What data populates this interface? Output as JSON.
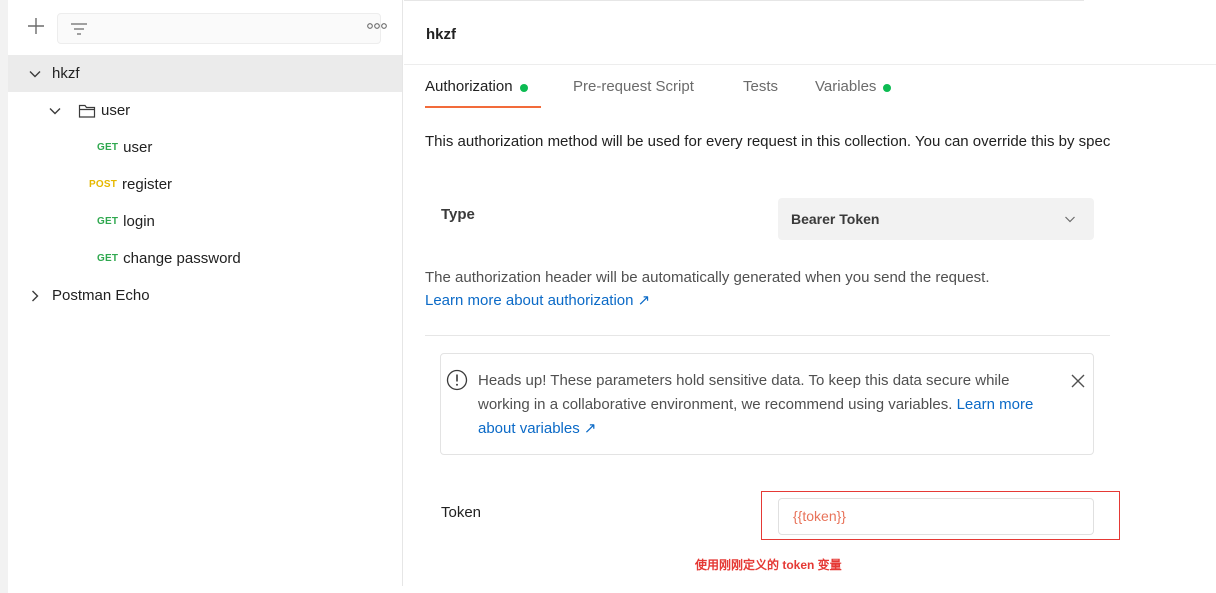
{
  "sidebar": {
    "add_icon": "plus-icon",
    "filter_icon": "filter-icon",
    "more_icon": "more-horizontal-icon",
    "tree": [
      {
        "label": "hkzf",
        "method": "",
        "expanded": true,
        "selected": true
      },
      {
        "label": "user",
        "method": "",
        "expanded": true,
        "folder": true
      },
      {
        "label": "user",
        "method": "GET"
      },
      {
        "label": "register",
        "method": "POST"
      },
      {
        "label": "login",
        "method": "GET"
      },
      {
        "label": "change password",
        "method": "GET"
      },
      {
        "label": "Postman Echo",
        "method": "",
        "expanded": false
      }
    ]
  },
  "collection": {
    "title": "hkzf",
    "tabs": [
      {
        "label": "Authorization",
        "has_dot": true,
        "active": true
      },
      {
        "label": "Pre-request Script",
        "has_dot": false
      },
      {
        "label": "Tests",
        "has_dot": false
      },
      {
        "label": "Variables",
        "has_dot": true
      }
    ],
    "description": "This authorization method will be used for every request in this collection. You can override this by spec"
  },
  "auth": {
    "type_label": "Type",
    "type_value": "Bearer Token",
    "info_text": "The authorization header will be automatically generated when you send the request.",
    "info_link": "Learn more about authorization ↗",
    "alert": {
      "text": "Heads up! These parameters hold sensitive data. To keep this data secure while working in a collaborative environment, we recommend using variables.",
      "link": "Learn more about variables ↗"
    },
    "token_label": "Token",
    "token_value": "{{token}}"
  },
  "annotation": "使用刚刚定义的 token 变量",
  "colors": {
    "accent": "#f26b3a",
    "dot_green": "#0cbb52",
    "get": "#2fa84f",
    "post": "#e6b800",
    "link": "#0b6ac7",
    "annotation_red": "#e53935"
  }
}
